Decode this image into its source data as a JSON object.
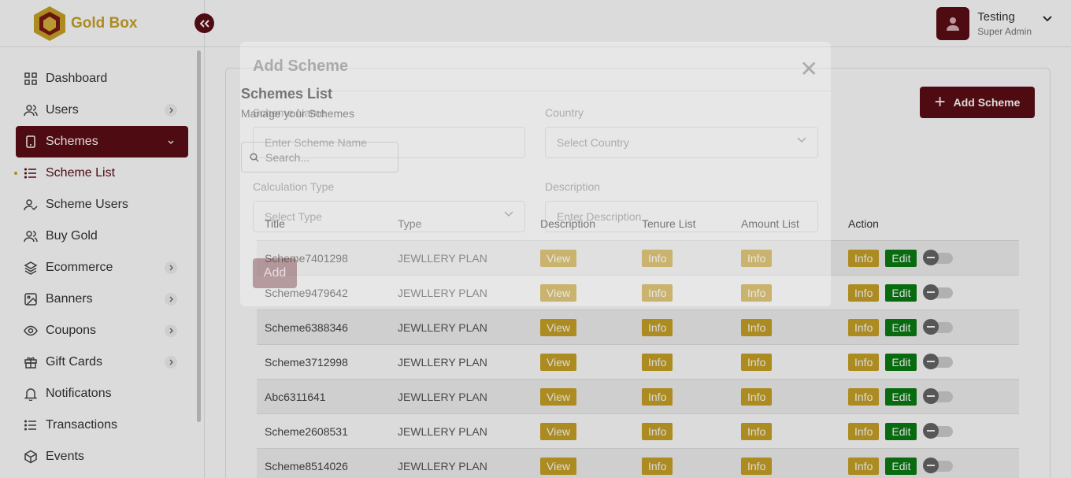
{
  "brand": {
    "name": "Gold Box",
    "collapse_icon": "double-chevron-left-icon"
  },
  "user": {
    "name": "Testing",
    "role": "Super Admin"
  },
  "sidebar": {
    "items": [
      {
        "label": "Dashboard",
        "icon": "grid-icon"
      },
      {
        "label": "Users",
        "icon": "users-icon"
      },
      {
        "label": "Schemes",
        "icon": "phone-icon"
      },
      {
        "label": "Scheme List",
        "icon": "list-icon"
      },
      {
        "label": "Scheme Users",
        "icon": "user-check-icon"
      },
      {
        "label": "Buy Gold",
        "icon": "users-icon"
      },
      {
        "label": "Ecommerce",
        "icon": "layers-icon"
      },
      {
        "label": "Banners",
        "icon": "image-icon"
      },
      {
        "label": "Coupons",
        "icon": "eye-icon"
      },
      {
        "label": "Gift Cards",
        "icon": "gift-icon"
      },
      {
        "label": "Notificatons",
        "icon": "bell-icon"
      },
      {
        "label": "Transactions",
        "icon": "list-icon"
      },
      {
        "label": "Events",
        "icon": "box-icon"
      }
    ]
  },
  "page": {
    "title": "Schemes List",
    "subtitle": "Manage your Schemes",
    "add_button": "Add Scheme",
    "search_placeholder": "Search..."
  },
  "table": {
    "headers": [
      "Title",
      "Type",
      "Description",
      "Tenure List",
      "Amount List",
      "Action"
    ],
    "view_label": "View",
    "info_label": "Info",
    "edit_label": "Edit",
    "rows": [
      {
        "title": "Scheme7401298",
        "type": "JEWLLERY PLAN"
      },
      {
        "title": "Scheme9479642",
        "type": "JEWLLERY PLAN"
      },
      {
        "title": "Scheme6388346",
        "type": "JEWLLERY PLAN"
      },
      {
        "title": "Scheme3712998",
        "type": "JEWLLERY PLAN"
      },
      {
        "title": "Abc6311641",
        "type": "JEWLLERY PLAN"
      },
      {
        "title": "Scheme2608531",
        "type": "JEWLLERY PLAN"
      },
      {
        "title": "Scheme8514026",
        "type": "JEWLLERY PLAN"
      }
    ]
  },
  "modal": {
    "title": "Add Scheme",
    "name_label": "Scheme Name",
    "name_placeholder": "Enter Scheme Name",
    "country_label": "Country",
    "country_placeholder": "Select Country",
    "calc_label": "Calculation Type",
    "calc_placeholder": "Select Type",
    "desc_label": "Description",
    "desc_placeholder": "Enter Description",
    "add_label": "Add"
  },
  "colors": {
    "primary": "#5c0d16",
    "gold": "#c9a227",
    "green": "#0a7d13"
  }
}
